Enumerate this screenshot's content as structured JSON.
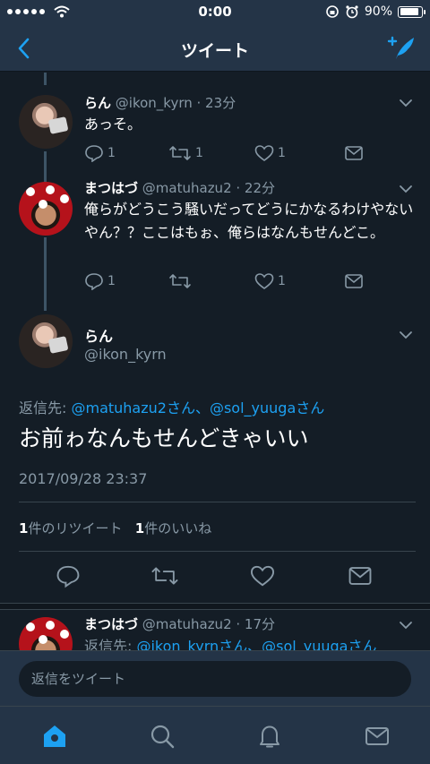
{
  "status_bar": {
    "time": "0:00",
    "battery": "90%",
    "battery_level": 0.9
  },
  "nav": {
    "title": "ツイート"
  },
  "thread": [
    {
      "name": "らん",
      "handle_time": "@ikon_kyrn · 23分",
      "text": "あっそ。",
      "reply_count": "1",
      "retweet_count": "1",
      "like_count": "1"
    },
    {
      "name": "まつはづ",
      "handle_time": "@matuhazu2 · 22分",
      "text": "俺らがどうこう騒いだってどうにかなるわけやないやん？？ここはもぉ、俺らはなんもせんどこ。",
      "reply_count": "1",
      "retweet_count": "",
      "like_count": "1"
    }
  ],
  "focused": {
    "name": "らん",
    "handle": "@ikon_kyrn",
    "reply_prefix": "返信先: ",
    "reply_user1": "@matuhazu2",
    "reply_joiner1": "さん、",
    "reply_user2": "@sol_yuuga",
    "reply_joiner2": "さん",
    "text": "お前ゎなんもせんどきゃいい",
    "date": "2017/09/28 23:37",
    "retweet_num": "1",
    "retweet_label": "件のリツイート",
    "like_num": "1",
    "like_label": "件のいいね"
  },
  "next_reply": {
    "name": "まつはづ",
    "handle_time": "@matuhazu2 · 17分",
    "reply_prefix": "返信先: ",
    "reply_user1": "@ikon_kyrn",
    "reply_joiner1": "さん、",
    "reply_user2": "@sol_yuuga",
    "reply_joiner2": "さん"
  },
  "composer": {
    "placeholder": "返信をツイート"
  },
  "colors": {
    "accent": "#1da1f2",
    "background": "#141d26",
    "bar": "#243447",
    "muted": "#8899a6"
  }
}
